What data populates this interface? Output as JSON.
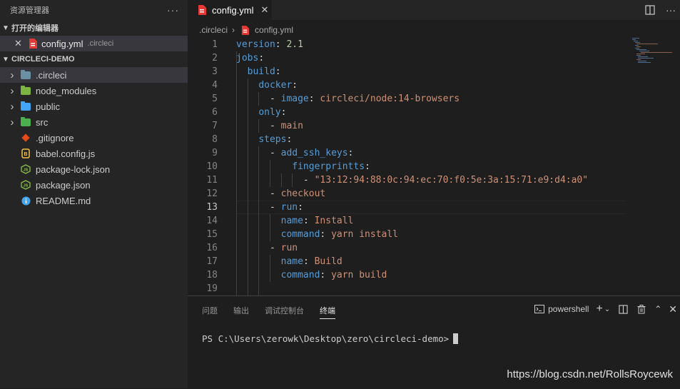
{
  "explorer": {
    "title": "资源管理器",
    "more": "···",
    "open_editors": {
      "header": "打开的编辑器",
      "item": {
        "close": "✕",
        "name": "config.yml",
        "dir": ".circleci"
      }
    },
    "project": {
      "header": "CIRCLECI-DEMO",
      "items": [
        {
          "name": ".circleci",
          "type": "folder",
          "color": "#6b8fa3"
        },
        {
          "name": "node_modules",
          "type": "folder",
          "color": "#7cb342"
        },
        {
          "name": "public",
          "type": "folder",
          "color": "#42a5f5"
        },
        {
          "name": "src",
          "type": "folder",
          "color": "#4caf50"
        },
        {
          "name": ".gitignore",
          "type": "file",
          "icon": "git-icon",
          "color": "#e64a19"
        },
        {
          "name": "babel.config.js",
          "type": "file",
          "icon": "babel-icon",
          "color": "#f5c242"
        },
        {
          "name": "package-lock.json",
          "type": "file",
          "icon": "nodejs-icon",
          "color": "#8bc34a"
        },
        {
          "name": "package.json",
          "type": "file",
          "icon": "nodejs-icon",
          "color": "#8bc34a"
        },
        {
          "name": "README.md",
          "type": "file",
          "icon": "info-icon",
          "color": "#42a5f5"
        }
      ]
    }
  },
  "tab": {
    "name": "config.yml",
    "close": "✕"
  },
  "breadcrumb": {
    "folder": ".circleci",
    "sep": "›",
    "file": "config.yml"
  },
  "editor": {
    "active_line": 13,
    "lines": [
      {
        "n": "1",
        "tokens": [
          [
            "k",
            "version"
          ],
          [
            "p",
            ": "
          ],
          [
            "n",
            "2.1"
          ]
        ]
      },
      {
        "n": "2",
        "tokens": [
          [
            "k",
            "jobs"
          ],
          [
            "p",
            ":"
          ]
        ]
      },
      {
        "n": "3",
        "tokens": [
          [
            "p",
            "  "
          ],
          [
            "k",
            "build"
          ],
          [
            "p",
            ":"
          ]
        ]
      },
      {
        "n": "4",
        "tokens": [
          [
            "p",
            "    "
          ],
          [
            "k",
            "docker"
          ],
          [
            "p",
            ":"
          ]
        ]
      },
      {
        "n": "5",
        "tokens": [
          [
            "p",
            "      - "
          ],
          [
            "k",
            "image"
          ],
          [
            "p",
            ": "
          ],
          [
            "v",
            "circleci/node:14-browsers"
          ]
        ]
      },
      {
        "n": "6",
        "tokens": [
          [
            "p",
            "    "
          ],
          [
            "k",
            "only"
          ],
          [
            "p",
            ":"
          ]
        ]
      },
      {
        "n": "7",
        "tokens": [
          [
            "p",
            "      - "
          ],
          [
            "v",
            "main"
          ]
        ]
      },
      {
        "n": "8",
        "tokens": [
          [
            "p",
            "    "
          ],
          [
            "k",
            "steps"
          ],
          [
            "p",
            ":"
          ]
        ]
      },
      {
        "n": "9",
        "tokens": [
          [
            "p",
            "      - "
          ],
          [
            "k",
            "add_ssh_keys"
          ],
          [
            "p",
            ":"
          ]
        ]
      },
      {
        "n": "10",
        "tokens": [
          [
            "p",
            "          "
          ],
          [
            "k",
            "fingerprintts"
          ],
          [
            "p",
            ":"
          ]
        ]
      },
      {
        "n": "11",
        "tokens": [
          [
            "p",
            "            - "
          ],
          [
            "v",
            "\"13:12:94:88:0c:94:ec:70:f0:5e:3a:15:71:e9:d4:a0\""
          ]
        ]
      },
      {
        "n": "12",
        "tokens": [
          [
            "p",
            "      - "
          ],
          [
            "v",
            "checkout"
          ]
        ]
      },
      {
        "n": "13",
        "tokens": [
          [
            "p",
            "      - "
          ],
          [
            "k",
            "run"
          ],
          [
            "p",
            ":"
          ]
        ]
      },
      {
        "n": "14",
        "tokens": [
          [
            "p",
            "        "
          ],
          [
            "k",
            "name"
          ],
          [
            "p",
            ": "
          ],
          [
            "v",
            "Install"
          ]
        ]
      },
      {
        "n": "15",
        "tokens": [
          [
            "p",
            "        "
          ],
          [
            "k",
            "command"
          ],
          [
            "p",
            ": "
          ],
          [
            "v",
            "yarn install"
          ]
        ]
      },
      {
        "n": "16",
        "tokens": [
          [
            "p",
            "      - "
          ],
          [
            "v",
            "run"
          ]
        ]
      },
      {
        "n": "17",
        "tokens": [
          [
            "p",
            "        "
          ],
          [
            "k",
            "name"
          ],
          [
            "p",
            ": "
          ],
          [
            "v",
            "Build"
          ]
        ]
      },
      {
        "n": "18",
        "tokens": [
          [
            "p",
            "        "
          ],
          [
            "k",
            "command"
          ],
          [
            "p",
            ": "
          ],
          [
            "v",
            "yarn build"
          ]
        ]
      },
      {
        "n": "19",
        "tokens": []
      }
    ]
  },
  "panel": {
    "tabs": [
      "问题",
      "输出",
      "调试控制台",
      "终端"
    ],
    "active_tab": 3,
    "shell": "powershell",
    "prompt": "PS C:\\Users\\zerowk\\Desktop\\zero\\circleci-demo>"
  },
  "watermark": "https://blog.csdn.net/RollsRoycewk",
  "colors": {
    "keyword": "#569cd6",
    "string": "#ce9178",
    "number": "#b5cea8",
    "yaml_file": "#e53935"
  }
}
